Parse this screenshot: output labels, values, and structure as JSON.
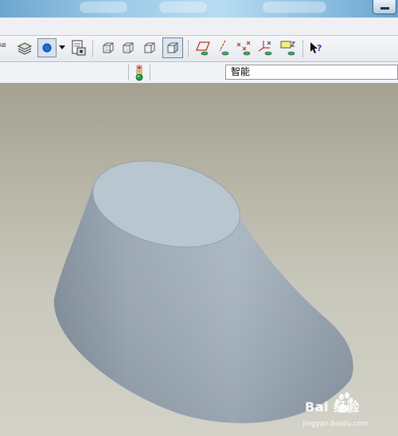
{
  "status": {
    "filter_value": "智能"
  },
  "icons": [
    "text-style-icon",
    "layers-icon",
    "display-style-icon",
    "dropdown-arrow-icon",
    "saved-view-icon",
    "wireframe-icon",
    "hidden-line-icon",
    "no-hidden-icon",
    "shading-icon",
    "datum-plane-icon",
    "datum-axis-icon",
    "datum-point-icon",
    "coordinate-system-icon",
    "annotation-icon",
    "whats-this-help-icon",
    "traffic-light-icon"
  ],
  "watermark": {
    "brand": "Bai 经验",
    "url": "jingyan.baidu.com"
  },
  "colors": {
    "viewport_top": "#a4a191",
    "viewport_bottom": "#d3d2c8",
    "model_surface": "#9aa7b3",
    "model_top_face": "#b8c6d0"
  }
}
